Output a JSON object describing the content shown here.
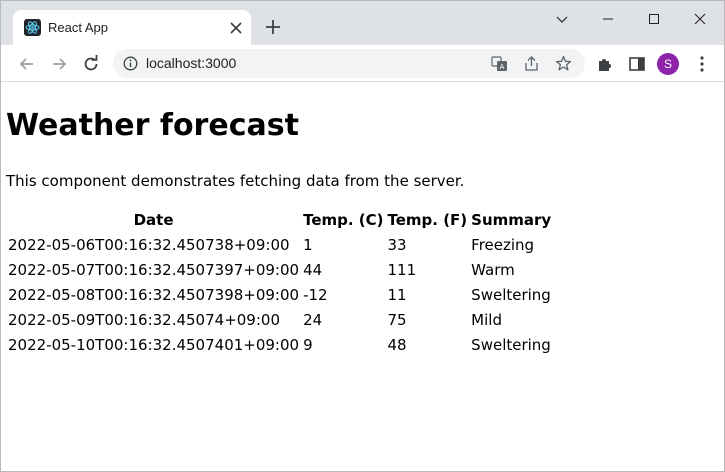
{
  "browser": {
    "tab_title": "React App",
    "url": "localhost:3000",
    "profile_initial": "S"
  },
  "page": {
    "title": "Weather forecast",
    "intro": "This component demonstrates fetching data from the server.",
    "table": {
      "headers": [
        "Date",
        "Temp. (C)",
        "Temp. (F)",
        "Summary"
      ],
      "rows": [
        [
          "2022-05-06T00:16:32.450738+09:00",
          "1",
          "33",
          "Freezing"
        ],
        [
          "2022-05-07T00:16:32.4507397+09:00",
          "44",
          "111",
          "Warm"
        ],
        [
          "2022-05-08T00:16:32.4507398+09:00",
          "-12",
          "11",
          "Sweltering"
        ],
        [
          "2022-05-09T00:16:32.45074+09:00",
          "24",
          "75",
          "Mild"
        ],
        [
          "2022-05-10T00:16:32.4507401+09:00",
          "9",
          "48",
          "Sweltering"
        ]
      ]
    }
  }
}
